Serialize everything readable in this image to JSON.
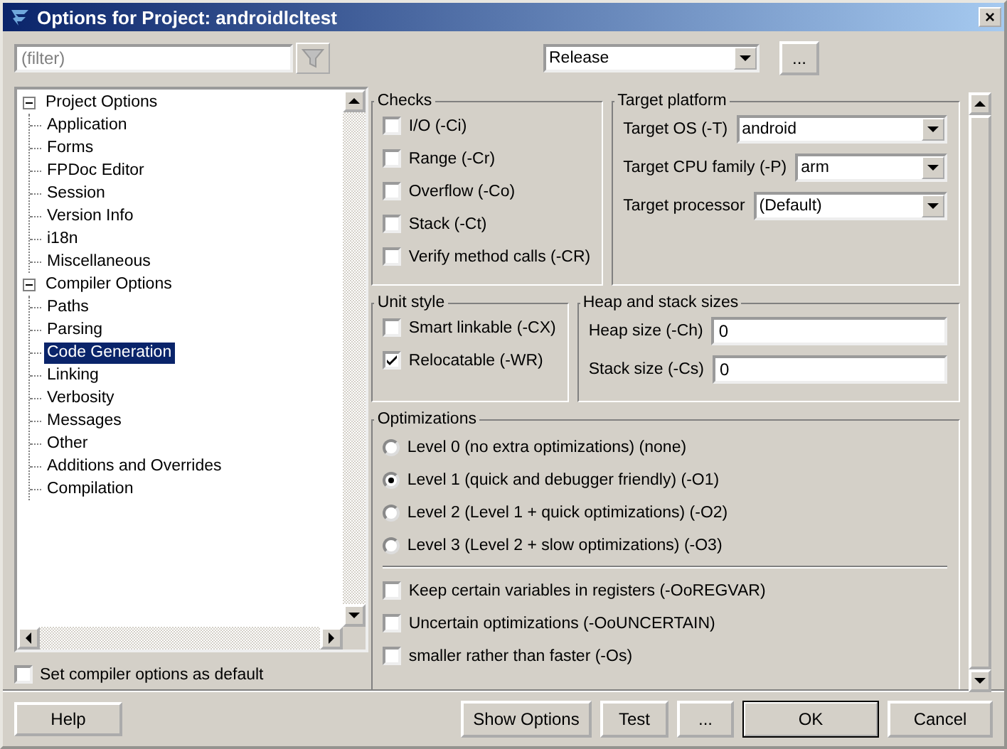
{
  "window": {
    "title": "Options for Project: androidlcltest",
    "close": "×"
  },
  "filter": {
    "placeholder": "(filter)"
  },
  "build_mode": {
    "value": "Release",
    "more": "..."
  },
  "tree": [
    {
      "label": "Project Options",
      "expanded": true,
      "selected": false,
      "children": [
        {
          "label": "Application",
          "selected": false
        },
        {
          "label": "Forms",
          "selected": false
        },
        {
          "label": "FPDoc Editor",
          "selected": false
        },
        {
          "label": "Session",
          "selected": false
        },
        {
          "label": "Version Info",
          "selected": false
        },
        {
          "label": "i18n",
          "selected": false
        },
        {
          "label": "Miscellaneous",
          "selected": false
        }
      ]
    },
    {
      "label": "Compiler Options",
      "expanded": true,
      "selected": false,
      "children": [
        {
          "label": "Paths",
          "selected": false
        },
        {
          "label": "Parsing",
          "selected": false
        },
        {
          "label": "Code Generation",
          "selected": true
        },
        {
          "label": "Linking",
          "selected": false
        },
        {
          "label": "Verbosity",
          "selected": false
        },
        {
          "label": "Messages",
          "selected": false
        },
        {
          "label": "Other",
          "selected": false
        },
        {
          "label": "Additions and Overrides",
          "selected": false
        },
        {
          "label": "Compilation",
          "selected": false
        }
      ]
    }
  ],
  "set_default": {
    "label": "Set compiler options as default",
    "checked": false
  },
  "checks": {
    "title": "Checks",
    "items": [
      {
        "label": "I/O (-Ci)",
        "checked": false
      },
      {
        "label": "Range (-Cr)",
        "checked": false
      },
      {
        "label": "Overflow (-Co)",
        "checked": false
      },
      {
        "label": "Stack (-Ct)",
        "checked": false
      },
      {
        "label": "Verify method calls (-CR)",
        "checked": false
      }
    ]
  },
  "target_platform": {
    "title": "Target platform",
    "fields": [
      {
        "label": "Target OS (-T)",
        "value": "android"
      },
      {
        "label": "Target CPU family (-P)",
        "value": "arm"
      },
      {
        "label": "Target processor",
        "value": "(Default)"
      }
    ]
  },
  "unit_style": {
    "title": "Unit style",
    "items": [
      {
        "label": "Smart linkable (-CX)",
        "checked": false
      },
      {
        "label": "Relocatable (-WR)",
        "checked": true
      }
    ]
  },
  "heap_sizes": {
    "title": "Heap and stack sizes",
    "fields": [
      {
        "label": "Heap size (-Ch)",
        "value": "0"
      },
      {
        "label": "Stack size (-Cs)",
        "value": "0"
      }
    ]
  },
  "optimizations": {
    "title": "Optimizations",
    "levels": [
      {
        "label": "Level 0 (no extra optimizations) (none)",
        "selected": false
      },
      {
        "label": "Level 1 (quick and debugger friendly) (-O1)",
        "selected": true
      },
      {
        "label": "Level 2 (Level 1 + quick optimizations) (-O2)",
        "selected": false
      },
      {
        "label": "Level 3 (Level 2 + slow optimizations) (-O3)",
        "selected": false
      }
    ],
    "options": [
      {
        "label": "Keep certain variables in registers (-OoREGVAR)",
        "checked": false
      },
      {
        "label": "Uncertain optimizations (-OoUNCERTAIN)",
        "checked": false
      },
      {
        "label": "smaller rather than faster (-Os)",
        "checked": false
      }
    ]
  },
  "help_button": "Help",
  "buttons": [
    {
      "label": "Show Options",
      "default": false
    },
    {
      "label": "Test",
      "default": false
    },
    {
      "label": "...",
      "default": false
    },
    {
      "label": "OK",
      "default": true
    },
    {
      "label": "Cancel",
      "default": false
    }
  ]
}
